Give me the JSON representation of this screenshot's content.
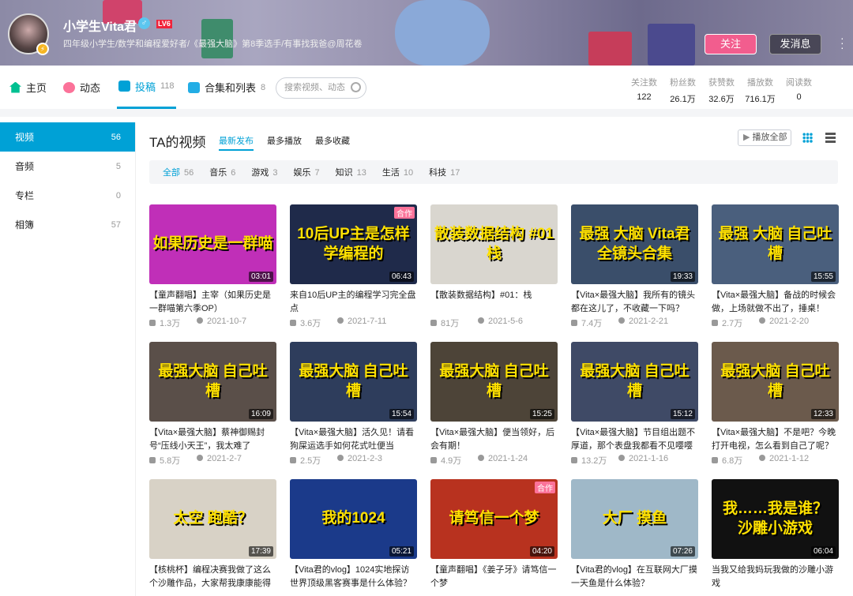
{
  "header": {
    "username": "小学生Vita君",
    "sex_icon": "♂",
    "level": "LV6",
    "sign": "四年级小学生/数学和编程爱好者/《最强大脑》第8季选手/有事找我爸@周花卷",
    "follow": "关注",
    "message": "发消息"
  },
  "nav": {
    "items": [
      {
        "label": "主页",
        "count": ""
      },
      {
        "label": "动态",
        "count": ""
      },
      {
        "label": "投稿",
        "count": "118"
      },
      {
        "label": "合集和列表",
        "count": "8"
      }
    ],
    "search_placeholder": "搜索视频、动态"
  },
  "stats": [
    {
      "label": "关注数",
      "value": "122"
    },
    {
      "label": "粉丝数",
      "value": "26.1万"
    },
    {
      "label": "获赞数",
      "value": "32.6万"
    },
    {
      "label": "播放数",
      "value": "716.1万"
    },
    {
      "label": "阅读数",
      "value": "0"
    }
  ],
  "sidebar": [
    {
      "label": "视频",
      "count": "56"
    },
    {
      "label": "音频",
      "count": "5"
    },
    {
      "label": "专栏",
      "count": "0"
    },
    {
      "label": "相簿",
      "count": "57"
    }
  ],
  "main": {
    "title": "TA的视频",
    "sorts": [
      "最新发布",
      "最多播放",
      "最多收藏"
    ],
    "play_all": "播放全部",
    "filters": [
      {
        "label": "全部",
        "count": "56"
      },
      {
        "label": "音乐",
        "count": "6"
      },
      {
        "label": "游戏",
        "count": "3"
      },
      {
        "label": "娱乐",
        "count": "7"
      },
      {
        "label": "知识",
        "count": "13"
      },
      {
        "label": "生活",
        "count": "10"
      },
      {
        "label": "科技",
        "count": "17"
      }
    ]
  },
  "videos": [
    {
      "cap": "如果历史是一群喵",
      "dur": "03:01",
      "tag": "",
      "title": "【童声翻唱】主宰（如果历史是一群喵第六季OP）",
      "plays": "1.3万",
      "date": "2021-10-7",
      "bg": "#c02fb8"
    },
    {
      "cap": "10后UP主是怎样学编程的",
      "dur": "06:43",
      "tag": "合作",
      "title": "来自10后UP主的编程学习完全盘点",
      "plays": "3.6万",
      "date": "2021-7-11",
      "bg": "#1f2a4a"
    },
    {
      "cap": "散装数据结构 #01 栈",
      "dur": "",
      "tag": "",
      "title": "【散装数据结构】#01：栈",
      "plays": "81万",
      "date": "2021-5-6",
      "bg": "#d9d6cf"
    },
    {
      "cap": "最强 大脑 Vita君 全镜头合集",
      "dur": "19:33",
      "tag": "",
      "title": "【Vita×最强大脑】我所有的镜头都在这儿了，不收藏一下吗？",
      "plays": "7.4万",
      "date": "2021-2-21",
      "bg": "#3a4e6a"
    },
    {
      "cap": "最强 大脑 自己吐槽",
      "dur": "15:55",
      "tag": "",
      "title": "【Vita×最强大脑】备战的时候会做，上场就做不出了，捶桌！",
      "plays": "2.7万",
      "date": "2021-2-20",
      "bg": "#4a5f7d"
    },
    {
      "cap": "最强大脑 自己吐槽",
      "dur": "16:09",
      "tag": "",
      "title": "【Vita×最强大脑】蔡神御赐封号“压线小天王”，我太难了",
      "plays": "5.8万",
      "date": "2021-2-7",
      "bg": "#5a4f49"
    },
    {
      "cap": "最强大脑 自己吐槽",
      "dur": "15:54",
      "tag": "",
      "title": "【Vita×最强大脑】活久见！请看狗屎运选手如何花式吐便当",
      "plays": "2.5万",
      "date": "2021-2-3",
      "bg": "#2e3d5c"
    },
    {
      "cap": "最强大脑 自己吐槽",
      "dur": "15:25",
      "tag": "",
      "title": "【Vita×最强大脑】便当领好，后会有期！",
      "plays": "4.9万",
      "date": "2021-1-24",
      "bg": "#4d4438"
    },
    {
      "cap": "最强大脑 自己吐槽",
      "dur": "15:12",
      "tag": "",
      "title": "【Vita×最强大脑】节目组出题不厚道，那个表盘我都看不见嘤嘤嘤",
      "plays": "13.2万",
      "date": "2021-1-16",
      "bg": "#3f4a66"
    },
    {
      "cap": "最强大脑 自己吐槽",
      "dur": "12:33",
      "tag": "",
      "title": "【Vita×最强大脑】不是吧？今晚打开电视，怎么看到自己了呢？",
      "plays": "6.8万",
      "date": "2021-1-12",
      "bg": "#6b5a4c"
    },
    {
      "cap": "太空 跑酷？",
      "dur": "17:39",
      "tag": "",
      "title": "【核桃杯】编程决赛我做了这么个沙雕作品，大家帮我康康能得几分",
      "plays": "",
      "date": "",
      "bg": "#d8d2c6"
    },
    {
      "cap": "我的1024",
      "dur": "05:21",
      "tag": "",
      "title": "【Vita君的vlog】1024实地探访世界顶级黑客赛事是什么体验？",
      "plays": "",
      "date": "",
      "bg": "#1b3a8a"
    },
    {
      "cap": "请笃信一个梦",
      "dur": "04:20",
      "tag": "合作",
      "title": "【童声翻唱】《姜子牙》请笃信一个梦",
      "plays": "",
      "date": "",
      "bg": "#b8321f"
    },
    {
      "cap": "大厂 摸鱼",
      "dur": "07:26",
      "tag": "",
      "title": "【Vita君的vlog】在互联网大厂摸一天鱼是什么体验？",
      "plays": "",
      "date": "",
      "bg": "#9fb8c8"
    },
    {
      "cap": "我……我是谁？ 沙雕小游戏",
      "dur": "06:04",
      "tag": "",
      "title": "当我又给我妈玩我做的沙雕小游戏",
      "plays": "",
      "date": "",
      "bg": "#111"
    }
  ]
}
